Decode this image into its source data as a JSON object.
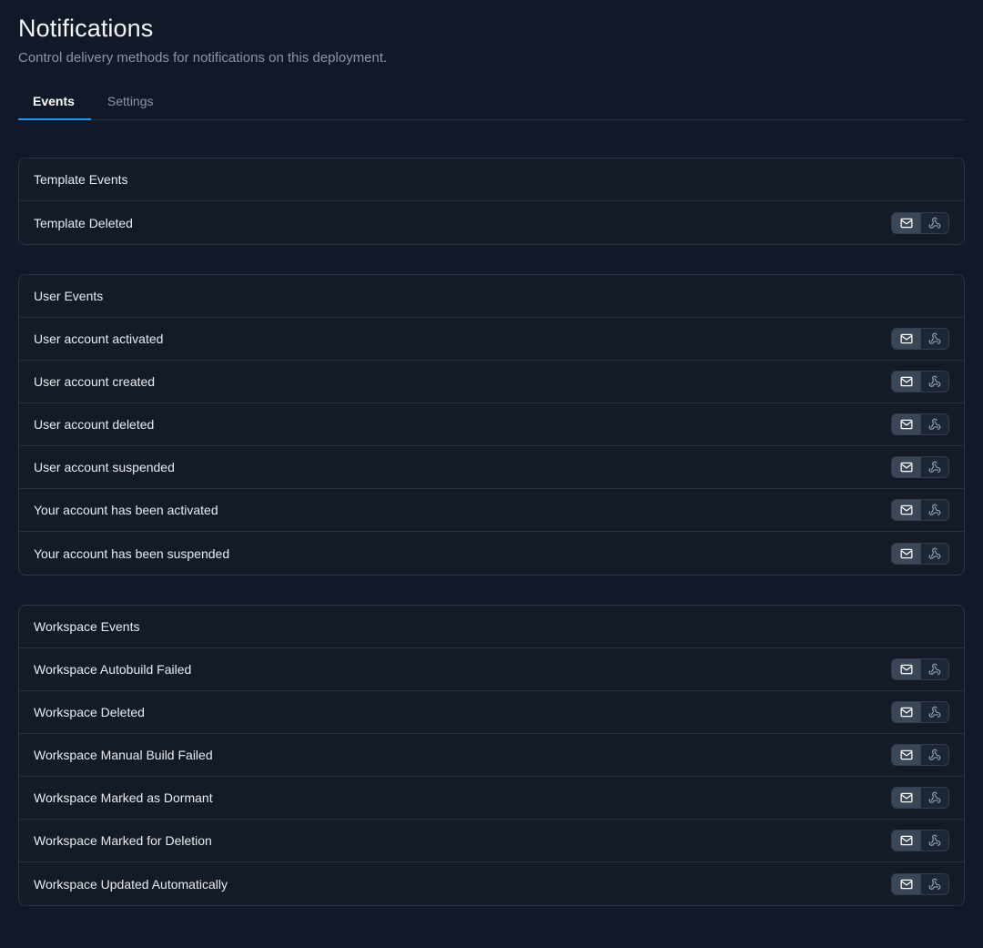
{
  "header": {
    "title": "Notifications",
    "subtitle": "Control delivery methods for notifications on this deployment."
  },
  "tabs": [
    {
      "label": "Events",
      "active": true
    },
    {
      "label": "Settings",
      "active": false
    }
  ],
  "toggles": {
    "email": {
      "icon": "envelope-icon",
      "label": "Email",
      "selected": true
    },
    "webhook": {
      "icon": "webhook-icon",
      "label": "Webhook",
      "selected": false
    }
  },
  "colors": {
    "page_background": "#111827",
    "card_background": "#141b27",
    "card_border": "#2b3846",
    "divider": "#26323f",
    "accent": "#2196f3",
    "text_primary": "#e8ecf2",
    "text_muted": "#8b95a5",
    "toggle_selected_background": "#3b4657"
  },
  "cards": [
    {
      "title": "Template Events",
      "events": [
        {
          "label": "Template Deleted",
          "email_selected": true,
          "webhook_selected": false
        }
      ]
    },
    {
      "title": "User Events",
      "events": [
        {
          "label": "User account activated",
          "email_selected": true,
          "webhook_selected": false
        },
        {
          "label": "User account created",
          "email_selected": true,
          "webhook_selected": false
        },
        {
          "label": "User account deleted",
          "email_selected": true,
          "webhook_selected": false
        },
        {
          "label": "User account suspended",
          "email_selected": true,
          "webhook_selected": false
        },
        {
          "label": "Your account has been activated",
          "email_selected": true,
          "webhook_selected": false
        },
        {
          "label": "Your account has been suspended",
          "email_selected": true,
          "webhook_selected": false
        }
      ]
    },
    {
      "title": "Workspace Events",
      "events": [
        {
          "label": "Workspace Autobuild Failed",
          "email_selected": true,
          "webhook_selected": false
        },
        {
          "label": "Workspace Deleted",
          "email_selected": true,
          "webhook_selected": false
        },
        {
          "label": "Workspace Manual Build Failed",
          "email_selected": true,
          "webhook_selected": false
        },
        {
          "label": "Workspace Marked as Dormant",
          "email_selected": true,
          "webhook_selected": false
        },
        {
          "label": "Workspace Marked for Deletion",
          "email_selected": true,
          "webhook_selected": false
        },
        {
          "label": "Workspace Updated Automatically",
          "email_selected": true,
          "webhook_selected": false
        }
      ]
    }
  ]
}
